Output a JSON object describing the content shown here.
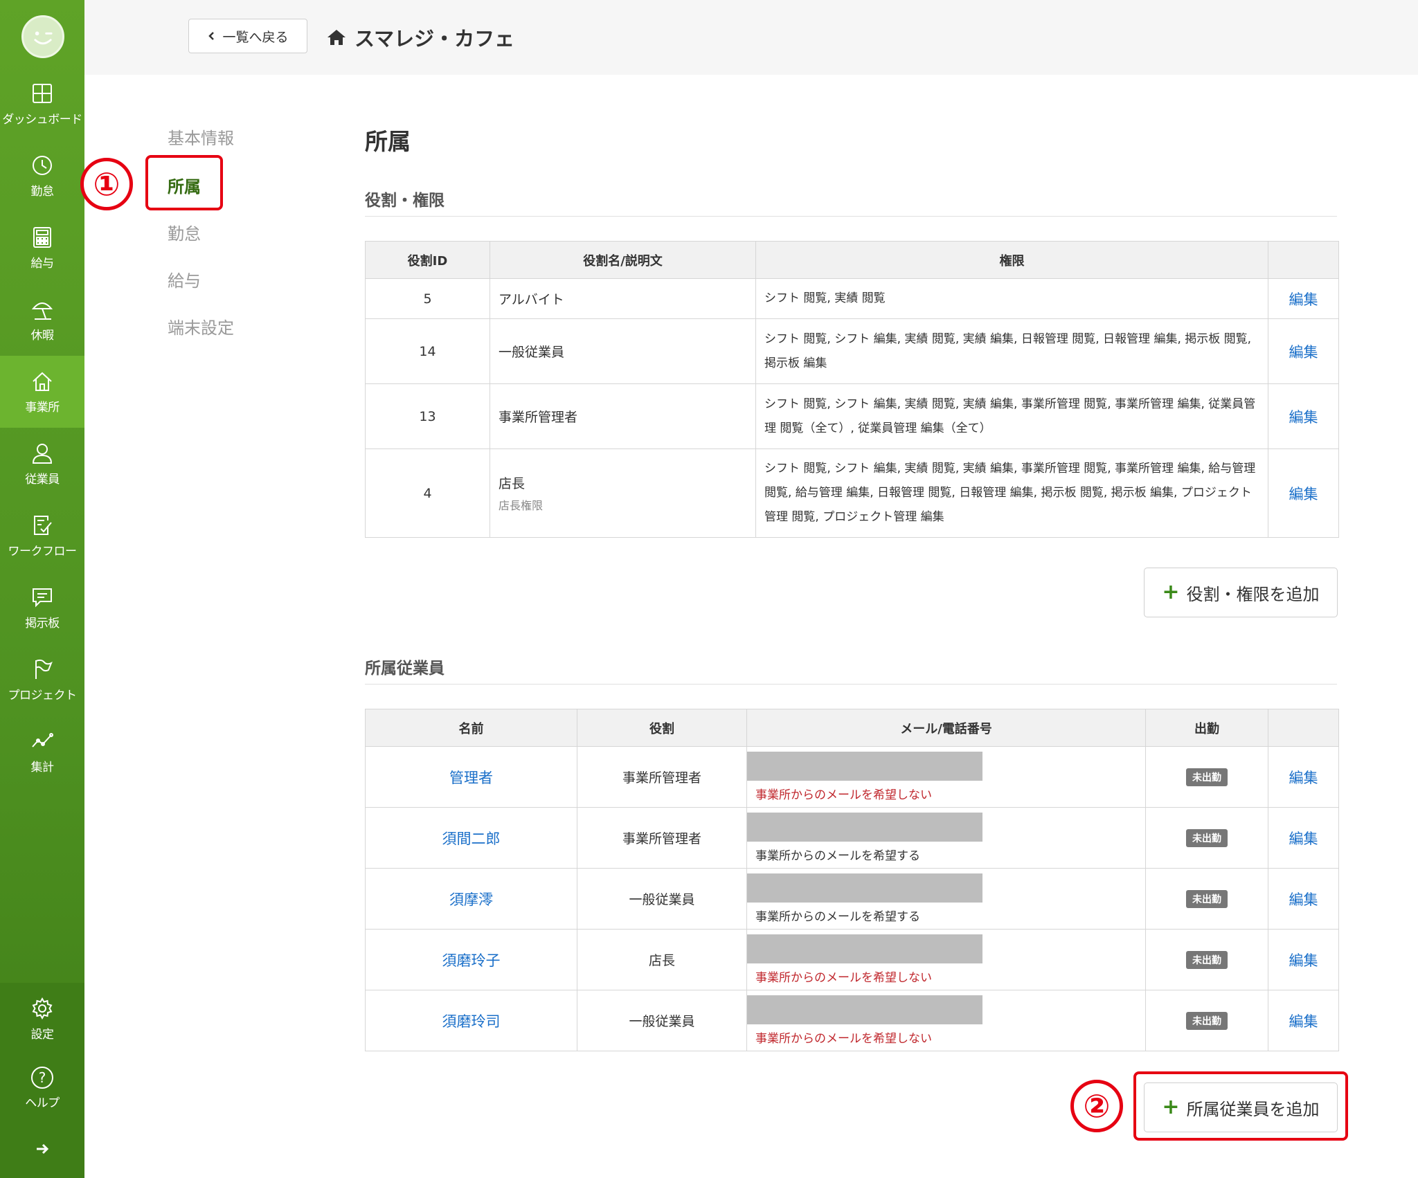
{
  "sidebar": {
    "items": [
      {
        "label": "ダッシュボード",
        "icon": "dashboard-icon"
      },
      {
        "label": "勤怠",
        "icon": "clock-icon"
      },
      {
        "label": "給与",
        "icon": "calculator-icon"
      },
      {
        "label": "休暇",
        "icon": "beach-umbrella-icon"
      },
      {
        "label": "事業所",
        "icon": "home-icon"
      },
      {
        "label": "従業員",
        "icon": "user-icon"
      },
      {
        "label": "ワークフロー",
        "icon": "checklist-icon"
      },
      {
        "label": "掲示板",
        "icon": "chat-icon"
      },
      {
        "label": "プロジェクト",
        "icon": "flag-icon"
      },
      {
        "label": "集計",
        "icon": "line-chart-icon"
      }
    ],
    "settings_label": "設定",
    "help_label": "ヘルプ",
    "help_icon_text": "?"
  },
  "header": {
    "back_label": "一覧へ戻る",
    "store_name": "スマレジ・カフェ"
  },
  "subnav": {
    "items": [
      "基本情報",
      "所属",
      "勤怠",
      "給与",
      "端末設定"
    ]
  },
  "annotations": {
    "one": "①",
    "two": "②"
  },
  "main": {
    "page_title": "所属",
    "roles": {
      "section_title": "役割・権限",
      "headers": [
        "役割ID",
        "役割名/説明文",
        "権限",
        ""
      ],
      "rows": [
        {
          "id": "5",
          "name": "アルバイト",
          "desc": "",
          "perm": "シフト 閲覧, 実績 閲覧",
          "edit": "編集"
        },
        {
          "id": "14",
          "name": "一般従業員",
          "desc": "",
          "perm": "シフト 閲覧, シフト 編集, 実績 閲覧, 実績 編集, 日報管理 閲覧, 日報管理 編集, 掲示板 閲覧, 掲示板 編集",
          "edit": "編集"
        },
        {
          "id": "13",
          "name": "事業所管理者",
          "desc": "",
          "perm": "シフト 閲覧, シフト 編集, 実績 閲覧, 実績 編集, 事業所管理 閲覧, 事業所管理 編集, 従業員管理 閲覧（全て）, 従業員管理 編集（全て）",
          "edit": "編集"
        },
        {
          "id": "4",
          "name": "店長",
          "desc": "店長権限",
          "perm": "シフト 閲覧, シフト 編集, 実績 閲覧, 実績 編集, 事業所管理 閲覧, 事業所管理 編集, 給与管理 閲覧, 給与管理 編集, 日報管理 閲覧, 日報管理 編集, 掲示板 閲覧, 掲示板 編集, プロジェクト管理 閲覧, プロジェクト管理 編集",
          "edit": "編集"
        }
      ],
      "add_label": "役割・権限を追加"
    },
    "members": {
      "section_title": "所属従業員",
      "headers": [
        "名前",
        "役割",
        "メール/電話番号",
        "出勤",
        ""
      ],
      "rows": [
        {
          "name": "管理者",
          "role": "事業所管理者",
          "mail_pref": "事業所からのメールを希望しない",
          "mail_ok": false,
          "status": "未出勤",
          "edit": "編集"
        },
        {
          "name": "須間二郎",
          "role": "事業所管理者",
          "mail_pref": "事業所からのメールを希望する",
          "mail_ok": true,
          "status": "未出勤",
          "edit": "編集"
        },
        {
          "name": "須摩澪",
          "role": "一般従業員",
          "mail_pref": "事業所からのメールを希望する",
          "mail_ok": true,
          "status": "未出勤",
          "edit": "編集"
        },
        {
          "name": "須磨玲子",
          "role": "店長",
          "mail_pref": "事業所からのメールを希望しない",
          "mail_ok": false,
          "status": "未出勤",
          "edit": "編集"
        },
        {
          "name": "須磨玲司",
          "role": "一般従業員",
          "mail_pref": "事業所からのメールを希望しない",
          "mail_ok": false,
          "status": "未出勤",
          "edit": "編集"
        }
      ],
      "add_label": "所属従業員を追加"
    }
  },
  "colors": {
    "sidebar_green": "#4f9221",
    "active_green": "#6cb42f",
    "link_blue": "#1a6fc9",
    "highlight_red": "#e60012",
    "warning_red": "#c0272d"
  }
}
